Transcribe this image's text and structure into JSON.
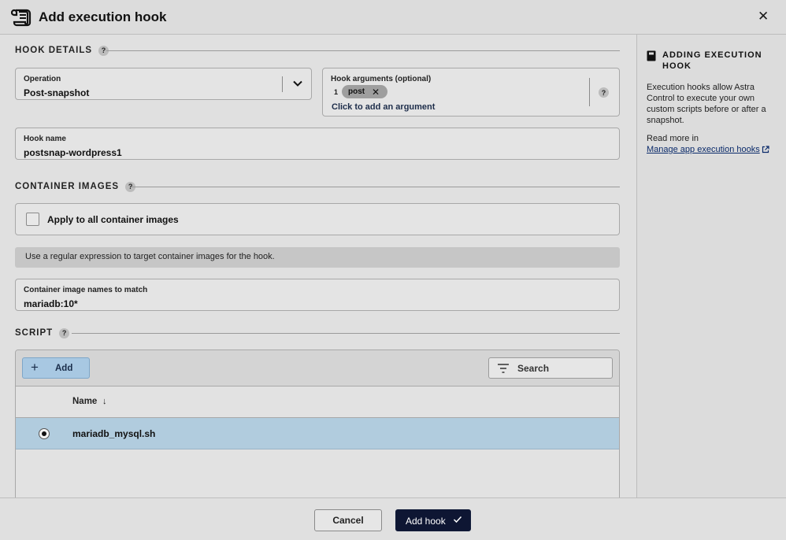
{
  "dialog": {
    "title": "Add execution hook"
  },
  "hook_details": {
    "heading": "HOOK DETAILS",
    "help": "?",
    "operation": {
      "label": "Operation",
      "value": "Post-snapshot"
    },
    "hook_arguments": {
      "label": "Hook arguments (optional)",
      "index": "1",
      "chip": "post",
      "add_link": "Click to add an argument",
      "help": "?"
    },
    "hook_name": {
      "label": "Hook name",
      "value": "postsnap-wordpress1"
    }
  },
  "container_images": {
    "heading": "CONTAINER IMAGES",
    "help": "?",
    "apply_all_label": "Apply to all container images",
    "apply_all_checked": false,
    "info": "Use a regular expression to target container images for the hook.",
    "match": {
      "label": "Container image names to match",
      "value": "mariadb:10*"
    }
  },
  "script": {
    "heading": "SCRIPT",
    "help": "?",
    "add_label": "Add",
    "search_label": "Search",
    "columns": [
      "Name"
    ],
    "rows": [
      {
        "name": "mariadb_mysql.sh",
        "selected": true
      }
    ]
  },
  "sidebar": {
    "heading_line1": "ADDING EXECUTION",
    "heading_line2": "HOOK",
    "description": "Execution hooks allow Astra Control to execute your own custom scripts before or after a snapshot.",
    "read_more": "Read more in",
    "link": "Manage app execution hooks"
  },
  "footer": {
    "cancel": "Cancel",
    "submit": "Add hook"
  },
  "colors": {
    "primary": "#0e1633",
    "selected_row": "#b1ccde",
    "add_button": "#a8c8e2",
    "link": "#0a2a6a"
  }
}
